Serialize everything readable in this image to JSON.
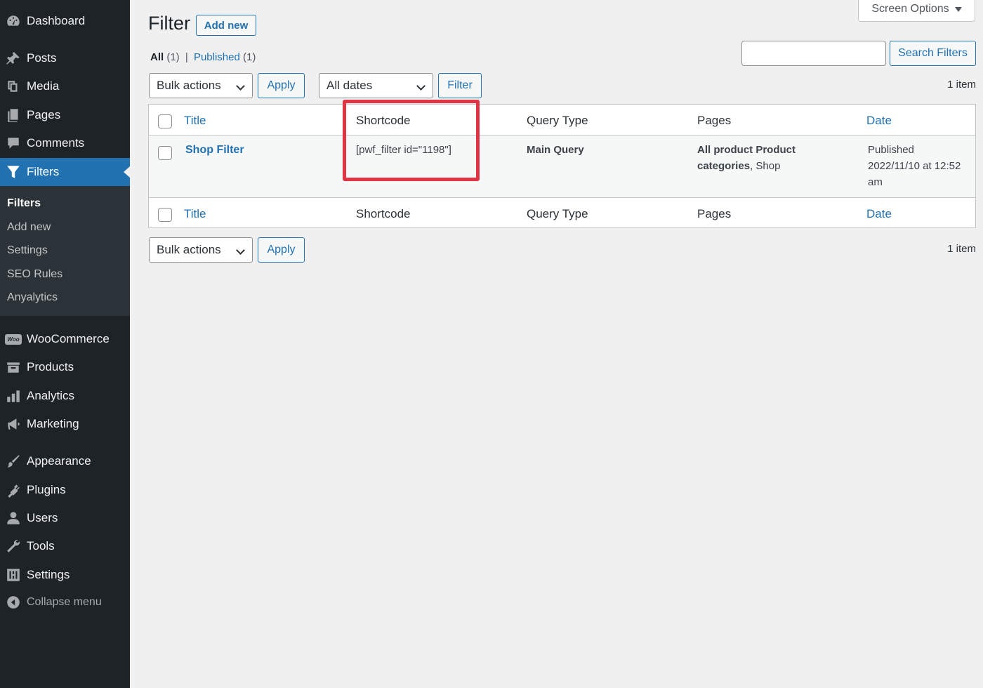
{
  "sidebar": {
    "items": [
      {
        "label": "Dashboard",
        "icon": "dashboard-icon"
      },
      {
        "label": "Posts",
        "icon": "pin-icon"
      },
      {
        "label": "Media",
        "icon": "media-icon"
      },
      {
        "label": "Pages",
        "icon": "pages-icon"
      },
      {
        "label": "Comments",
        "icon": "comment-icon"
      },
      {
        "label": "Filters",
        "icon": "filter-icon"
      },
      {
        "label": "WooCommerce",
        "icon": "woo-icon"
      },
      {
        "label": "Products",
        "icon": "products-icon"
      },
      {
        "label": "Analytics",
        "icon": "bar-chart-icon"
      },
      {
        "label": "Marketing",
        "icon": "megaphone-icon"
      },
      {
        "label": "Appearance",
        "icon": "brush-icon"
      },
      {
        "label": "Plugins",
        "icon": "plug-icon"
      },
      {
        "label": "Users",
        "icon": "user-icon"
      },
      {
        "label": "Tools",
        "icon": "wrench-icon"
      },
      {
        "label": "Settings",
        "icon": "settings-icon"
      }
    ],
    "submenu": [
      "Filters",
      "Add new",
      "Settings",
      "SEO Rules",
      "Anyalytics"
    ],
    "collapse_label": "Collapse menu",
    "woo_badge": "Woo"
  },
  "header": {
    "title": "Filter",
    "add_new": "Add new",
    "screen_options": "Screen Options"
  },
  "views": {
    "all_label": "All",
    "all_count": "(1)",
    "separator": "|",
    "published_label": "Published",
    "published_count": "(1)"
  },
  "search": {
    "button": "Search Filters",
    "value": ""
  },
  "top_nav": {
    "bulk_actions": "Bulk actions",
    "apply": "Apply",
    "dates": "All dates",
    "filter": "Filter",
    "count": "1 item"
  },
  "table": {
    "columns": [
      "Title",
      "Shortcode",
      "Query Type",
      "Pages",
      "Date"
    ],
    "rows": [
      {
        "title": "Shop Filter",
        "shortcode": "[pwf_filter id=\"1198\"]",
        "query_type": "Main Query",
        "pages_bold": "All product Product categories",
        "pages_sep": ", ",
        "pages_rest": "Shop",
        "date_status": "Published",
        "date_value": "2022/11/10 at 12:52 am"
      }
    ]
  },
  "bottom_nav": {
    "bulk_actions": "Bulk actions",
    "apply": "Apply",
    "count": "1 item"
  },
  "colors": {
    "accent": "#2271b1",
    "sidebar": "#1d2327",
    "highlight": "#e03445"
  }
}
